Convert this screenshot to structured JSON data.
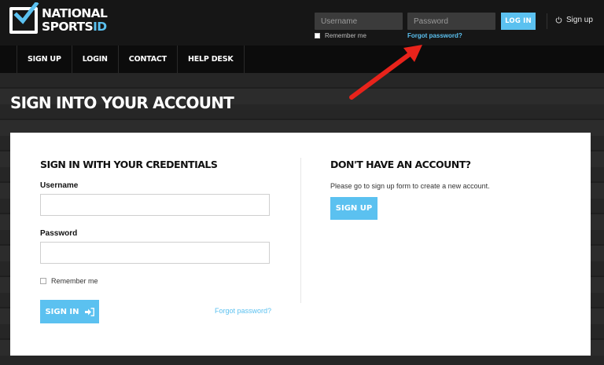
{
  "brand": {
    "line1": "NATIONAL",
    "line2_main": "SPORTS",
    "line2_accent": "ID",
    "accent_color": "#5bc1f0",
    "icon": "checkmark-logo-icon"
  },
  "header": {
    "username_placeholder": "Username",
    "password_placeholder": "Password",
    "login_label": "LOG IN",
    "remember_label": "Remember me",
    "forgot_label": "Forgot password?",
    "signup_label": "Sign up",
    "signup_icon": "power-icon"
  },
  "nav": {
    "items": [
      "SIGN UP",
      "LOGIN",
      "CONTACT",
      "HELP DESK"
    ]
  },
  "page": {
    "title": "SIGN INTO YOUR ACCOUNT"
  },
  "signin": {
    "title": "SIGN IN WITH YOUR CREDENTIALS",
    "username_label": "Username",
    "username_value": "",
    "password_label": "Password",
    "password_value": "",
    "remember_label": "Remember me",
    "button_label": "SIGN IN",
    "button_icon": "sign-in-arrow-icon",
    "forgot_label": "Forgot password?"
  },
  "register": {
    "title": "DON'T HAVE AN ACCOUNT?",
    "description": "Please go to sign up form to create a new account.",
    "button_label": "SIGN UP"
  },
  "annotation": {
    "arrow_color": "#e8231b"
  }
}
